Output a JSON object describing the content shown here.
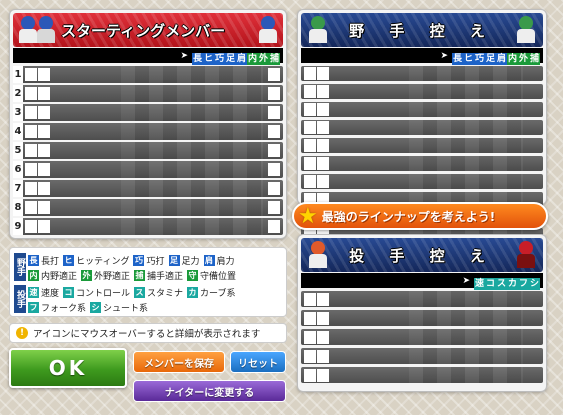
{
  "starting": {
    "title": "スターティングメンバー",
    "row_numbers": [
      "1",
      "2",
      "3",
      "4",
      "5",
      "6",
      "7",
      "8",
      "9"
    ]
  },
  "fielder_bench": {
    "title": "野 手 控 え",
    "row_count": 12
  },
  "pitcher_bench": {
    "title": "投 手 控 え",
    "row_count": 5
  },
  "fielder_stat_headers": [
    {
      "label": "長",
      "color": "#1d63c8"
    },
    {
      "label": "ヒ",
      "color": "#1d63c8"
    },
    {
      "label": "巧",
      "color": "#1d63c8"
    },
    {
      "label": "足",
      "color": "#1d63c8"
    },
    {
      "label": "肩",
      "color": "#1d63c8"
    },
    {
      "label": "内",
      "color": "#1a9a3a"
    },
    {
      "label": "外",
      "color": "#1a9a3a"
    },
    {
      "label": "捕",
      "color": "#1a9a3a"
    }
  ],
  "pitcher_stat_headers": [
    {
      "label": "速",
      "color": "#1aa8a0"
    },
    {
      "label": "コ",
      "color": "#1aa8a0"
    },
    {
      "label": "ス",
      "color": "#1aa8a0"
    },
    {
      "label": "カ",
      "color": "#1aa8a0"
    },
    {
      "label": "フ",
      "color": "#1aa8a0"
    },
    {
      "label": "シ",
      "color": "#1aa8a0"
    }
  ],
  "legend": {
    "fielder_label": "野手",
    "pitcher_label": "投手",
    "fielder_row1": [
      {
        "chip": "長",
        "text": "長打",
        "color": "#1d63c8"
      },
      {
        "chip": "ヒ",
        "text": "ヒッティング",
        "color": "#1d63c8"
      },
      {
        "chip": "巧",
        "text": "巧打",
        "color": "#1d63c8"
      },
      {
        "chip": "足",
        "text": "足力",
        "color": "#1d63c8"
      },
      {
        "chip": "肩",
        "text": "肩力",
        "color": "#1d63c8"
      }
    ],
    "fielder_row2": [
      {
        "chip": "内",
        "text": "内野適正",
        "color": "#1a9a3a"
      },
      {
        "chip": "外",
        "text": "外野適正",
        "color": "#1a9a3a"
      },
      {
        "chip": "捕",
        "text": "捕手適正",
        "color": "#1a9a3a"
      },
      {
        "chip": "守",
        "text": "守備位置",
        "color": "#1a9a3a"
      }
    ],
    "pitcher_row1": [
      {
        "chip": "速",
        "text": "速度",
        "color": "#1aa8a0"
      },
      {
        "chip": "コ",
        "text": "コントロール",
        "color": "#1aa8a0"
      },
      {
        "chip": "ス",
        "text": "スタミナ",
        "color": "#1aa8a0"
      },
      {
        "chip": "カ",
        "text": "カーブ系",
        "color": "#1aa8a0"
      }
    ],
    "pitcher_row2": [
      {
        "chip": "フ",
        "text": "フォーク系",
        "color": "#1aa8a0"
      },
      {
        "chip": "シ",
        "text": "シュート系",
        "color": "#1aa8a0"
      }
    ]
  },
  "hint": {
    "icon": "!",
    "text": "アイコンにマウスオーバーすると詳細が表示されます"
  },
  "buttons": {
    "ok": "OK",
    "save": "メンバーを保存",
    "reset": "リセット",
    "night": "ナイターに変更する"
  },
  "promo": {
    "text": "最強のラインナップを考えよう!"
  },
  "colors": {
    "starting_banner": "#c81e28",
    "bench_banner": "#1e3a78",
    "ok_button": "#3e9a1e",
    "save_button": "#ee7a14",
    "reset_button": "#1f7fd0",
    "night_button": "#6a3aa8"
  }
}
